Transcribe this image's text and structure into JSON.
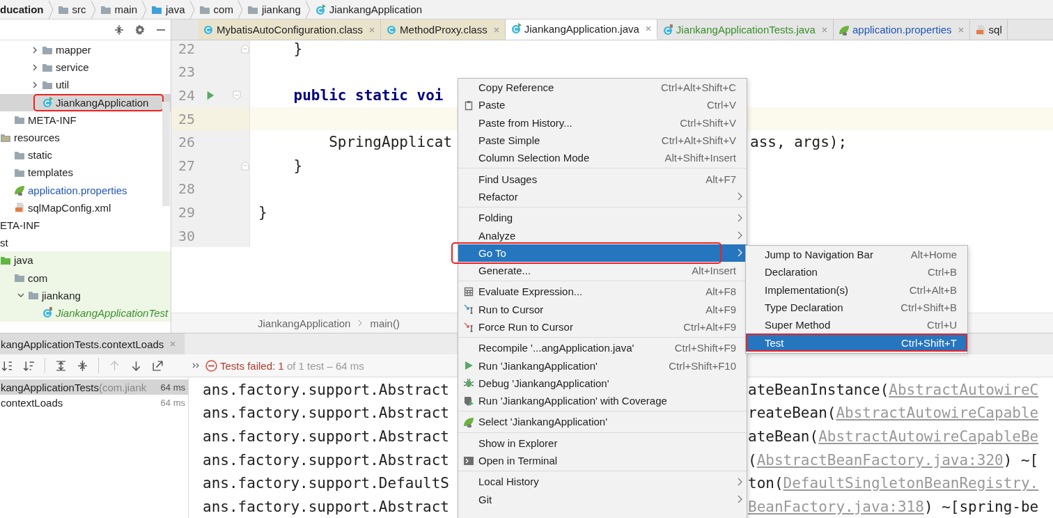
{
  "breadcrumb": [
    {
      "label": "ducation",
      "kind": "module"
    },
    {
      "label": "src",
      "kind": "folder"
    },
    {
      "label": "main",
      "kind": "folder"
    },
    {
      "label": "java",
      "kind": "source-folder"
    },
    {
      "label": "com",
      "kind": "folder"
    },
    {
      "label": "jiankang",
      "kind": "folder"
    },
    {
      "label": "JiankangApplication",
      "kind": "spring-class"
    }
  ],
  "editor_tabs": [
    {
      "label": "MybatisAutoConfiguration.class",
      "kind": "class",
      "color": "#222222",
      "selected": false,
      "closable": true
    },
    {
      "label": "MethodProxy.class",
      "kind": "class",
      "color": "#222222",
      "selected": false,
      "closable": true
    },
    {
      "label": "JiankangApplication.java",
      "kind": "spring-class",
      "color": "#222222",
      "selected": true,
      "closable": true
    },
    {
      "label": "JiankangApplicationTests.java",
      "kind": "test-class",
      "color": "#3a8f2a",
      "selected": false,
      "closable": true
    },
    {
      "label": "application.properties",
      "kind": "spring",
      "color": "#2156b4",
      "selected": false,
      "closable": true
    },
    {
      "label": "sql",
      "kind": "xml",
      "color": "#222222",
      "selected": false,
      "closable": false
    }
  ],
  "project_tree": [
    {
      "children": [
        {
          "children": [
            {
              "children": [
                {
                  "children": [
                    {
                      "label": "mapper",
                      "kind": "folder",
                      "expanded": false,
                      "selected": false,
                      "annotated": false,
                      "color": "#222222"
                    },
                    {
                      "label": "service",
                      "kind": "folder",
                      "expanded": false,
                      "selected": false,
                      "annotated": false,
                      "color": "#222222"
                    },
                    {
                      "label": "util",
                      "kind": "folder",
                      "expanded": false,
                      "selected": false,
                      "annotated": false,
                      "color": "#222222"
                    },
                    {
                      "label": "JiankangApplication",
                      "kind": "spring-class",
                      "selected": true,
                      "annotated": true,
                      "color": "#222222"
                    }
                  ]
                }
              ]
            },
            {
              "label": "META-INF",
              "kind": "folder",
              "selected": false,
              "annotated": false,
              "color": "#222222"
            }
          ]
        },
        {
          "label": "resources",
          "kind": "resources-root",
          "selected": false,
          "annotated": false,
          "color": "#222222",
          "children": [
            {
              "label": "static",
              "kind": "folder",
              "selected": false,
              "annotated": false,
              "color": "#222222"
            },
            {
              "label": "templates",
              "kind": "folder",
              "selected": false,
              "annotated": false,
              "color": "#222222"
            },
            {
              "label": "application.properties",
              "kind": "spring",
              "selected": false,
              "annotated": false,
              "color": "#2156b4"
            },
            {
              "label": "sqlMapConfig.xml",
              "kind": "xml",
              "selected": false,
              "annotated": false,
              "color": "#222222"
            }
          ]
        }
      ]
    },
    {
      "label": "ETA-INF",
      "selected": false,
      "annotated": false,
      "color": "#222222"
    },
    {
      "label": "st",
      "selected": false,
      "annotated": false,
      "color": "#222222",
      "tinted": true,
      "children": [
        {
          "label": "java",
          "kind": "test-root",
          "selected": false,
          "annotated": false,
          "color": "#222222",
          "children": [
            {
              "label": "com",
              "kind": "folder",
              "selected": false,
              "annotated": false,
              "color": "#222222",
              "children": [
                {
                  "label": "jiankang",
                  "kind": "folder",
                  "expanded": true,
                  "selected": false,
                  "annotated": false,
                  "color": "#222222",
                  "children": [
                    {
                      "label": "JiankangApplicationTest",
                      "kind": "test-class",
                      "selected": false,
                      "annotated": false,
                      "color": "#3a8f2a"
                    }
                  ]
                }
              ]
            }
          ]
        }
      ]
    }
  ],
  "code_lines": [
    {
      "number": "22",
      "text": "    }",
      "kind": "plain",
      "fold_start": false,
      "fold_end": true,
      "current": false,
      "run": false
    },
    {
      "number": "23",
      "fold_start": false,
      "fold_end": false,
      "current": false,
      "run": false
    },
    {
      "number": "24",
      "text": "    public static voi",
      "kind": "keyword",
      "fold_start": true,
      "fold_end": false,
      "current": false,
      "run": true
    },
    {
      "number": "25",
      "fold_start": false,
      "fold_end": false,
      "current": true,
      "run": false
    },
    {
      "number": "26",
      "text": "        SpringApplicat",
      "tail": "ass, args);",
      "kind": "plain",
      "fold_start": false,
      "fold_end": false,
      "current": false,
      "run": false
    },
    {
      "number": "27",
      "text": "    }",
      "kind": "plain",
      "fold_start": false,
      "fold_end": true,
      "current": false,
      "run": false
    },
    {
      "number": "28",
      "fold_start": false,
      "fold_end": false,
      "current": false,
      "run": false
    },
    {
      "number": "29",
      "text": "}",
      "kind": "plain",
      "fold_start": false,
      "fold_end": false,
      "current": false,
      "run": false
    },
    {
      "number": "30",
      "fold_start": false,
      "fold_end": false,
      "current": false,
      "run": false
    }
  ],
  "editor_breadcrumb": [
    "JiankangApplication",
    "main()"
  ],
  "run_panel": {
    "tab": "kangApplicationTests.contextLoads",
    "toolbar": [
      {
        "kind": "sort-alpha",
        "disabled": false
      },
      {
        "kind": "sort-duration",
        "disabled": false
      },
      {
        "kind": "expand-all",
        "disabled": false
      },
      {
        "kind": "collapse-all",
        "disabled": false
      },
      {
        "kind": "up",
        "disabled": true
      },
      {
        "kind": "down",
        "disabled": false
      },
      {
        "kind": "export",
        "disabled": false
      }
    ],
    "status": {
      "label": "Tests failed:",
      "count": "1",
      "summary": "of 1 test – 64 ms"
    },
    "tests": [
      {
        "name": "kangApplicationTests",
        "package": "(com.jiank",
        "time": "64 ms",
        "selected": true
      },
      {
        "name": "contextLoads",
        "time": "64 ms",
        "selected": false
      }
    ],
    "console": [
      {
        "left": "ans.factory.support.Abstract",
        "pre": "ateBeanInstance(",
        "link": "AbstractAutowireC"
      },
      {
        "left": "ans.factory.support.Abstract",
        "pre": "reateBean(",
        "link": "AbstractAutowireCapable"
      },
      {
        "left": "ans.factory.support.Abstract",
        "pre": "ateBean(",
        "link": "AbstractAutowireCapableBe"
      },
      {
        "left": "ans.factory.support.Abstract",
        "pre": "(",
        "link": "AbstractBeanFactory.java:320",
        "post": ") ~["
      },
      {
        "left": "ans.factory.support.DefaultS",
        "pre": "ton(",
        "link": "DefaultSingletonBeanRegistry."
      },
      {
        "left": "ans.factory.support.Abstract",
        "link": "BeanFactory.java:318",
        "post": ") ~[spring-be"
      }
    ]
  },
  "context_menu": {
    "groups": [
      [
        {
          "label": "Copy Reference",
          "shortcut": "Ctrl+Alt+Shift+C",
          "kind": "plain",
          "submenu": false,
          "selected": false,
          "annotated": false
        },
        {
          "label": "Paste",
          "shortcut": "Ctrl+V",
          "kind": "paste",
          "submenu": false,
          "selected": false,
          "annotated": false
        },
        {
          "label": "Paste from History...",
          "shortcut": "Ctrl+Shift+V",
          "kind": "plain",
          "submenu": false,
          "selected": false,
          "annotated": false
        },
        {
          "label": "Paste Simple",
          "shortcut": "Ctrl+Alt+Shift+V",
          "kind": "plain",
          "submenu": false,
          "selected": false,
          "annotated": false
        },
        {
          "label": "Column Selection Mode",
          "shortcut": "Alt+Shift+Insert",
          "kind": "plain",
          "submenu": false,
          "selected": false,
          "annotated": false
        }
      ],
      [
        {
          "label": "Find Usages",
          "shortcut": "Alt+F7",
          "kind": "plain",
          "submenu": false,
          "selected": false,
          "annotated": false
        },
        {
          "label": "Refactor",
          "kind": "plain",
          "submenu": true,
          "selected": false,
          "annotated": false
        }
      ],
      [
        {
          "label": "Folding",
          "kind": "plain",
          "submenu": true,
          "selected": false,
          "annotated": false
        },
        {
          "label": "Analyze",
          "kind": "plain",
          "submenu": true,
          "selected": false,
          "annotated": false
        },
        {
          "label": "Go To",
          "kind": "plain",
          "submenu": true,
          "selected": true,
          "annotated": true
        },
        {
          "label": "Generate...",
          "shortcut": "Alt+Insert",
          "kind": "plain",
          "submenu": false,
          "selected": false,
          "annotated": false
        }
      ],
      [
        {
          "label": "Evaluate Expression...",
          "shortcut": "Alt+F8",
          "kind": "calculator",
          "submenu": false,
          "selected": false,
          "annotated": false
        },
        {
          "label": "Run to Cursor",
          "shortcut": "Alt+F9",
          "kind": "run-cursor",
          "submenu": false,
          "selected": false,
          "annotated": false
        },
        {
          "label": "Force Run to Cursor",
          "shortcut": "Ctrl+Alt+F9",
          "kind": "force-run",
          "submenu": false,
          "selected": false,
          "annotated": false
        }
      ],
      [
        {
          "label": "Recompile '...angApplication.java'",
          "shortcut": "Ctrl+Shift+F9",
          "kind": "plain",
          "submenu": false,
          "selected": false,
          "annotated": false
        },
        {
          "label": "Run 'JiankangApplication'",
          "shortcut": "Ctrl+Shift+F10",
          "kind": "run",
          "submenu": false,
          "selected": false,
          "annotated": false
        },
        {
          "label": "Debug 'JiankangApplication'",
          "kind": "debug",
          "submenu": false,
          "selected": false,
          "annotated": false
        },
        {
          "label": "Run 'JiankangApplication' with Coverage",
          "kind": "coverage",
          "submenu": false,
          "selected": false,
          "annotated": false
        }
      ],
      [
        {
          "label": "Select 'JiankangApplication'",
          "kind": "spring",
          "submenu": false,
          "selected": false,
          "annotated": false
        }
      ],
      [
        {
          "label": "Show in Explorer",
          "kind": "plain",
          "submenu": false,
          "selected": false,
          "annotated": false
        },
        {
          "label": "Open in Terminal",
          "kind": "terminal",
          "submenu": false,
          "selected": false,
          "annotated": false
        }
      ],
      [
        {
          "label": "Local History",
          "kind": "plain",
          "submenu": true,
          "selected": false,
          "annotated": false
        },
        {
          "label": "Git",
          "kind": "plain",
          "submenu": true,
          "selected": false,
          "annotated": false
        }
      ]
    ]
  },
  "submenu": [
    {
      "label": "Jump to Navigation Bar",
      "shortcut": "Alt+Home",
      "selected": false,
      "annotated": false
    },
    {
      "label": "Declaration",
      "shortcut": "Ctrl+B",
      "selected": false,
      "annotated": false
    },
    {
      "label": "Implementation(s)",
      "shortcut": "Ctrl+Alt+B",
      "selected": false,
      "annotated": false
    },
    {
      "label": "Type Declaration",
      "shortcut": "Ctrl+Shift+B",
      "selected": false,
      "annotated": false
    },
    {
      "label": "Super Method",
      "shortcut": "Ctrl+U",
      "selected": false,
      "annotated": false
    },
    {
      "label": "Test",
      "shortcut": "Ctrl+Shift+T",
      "selected": true,
      "annotated": true
    }
  ]
}
